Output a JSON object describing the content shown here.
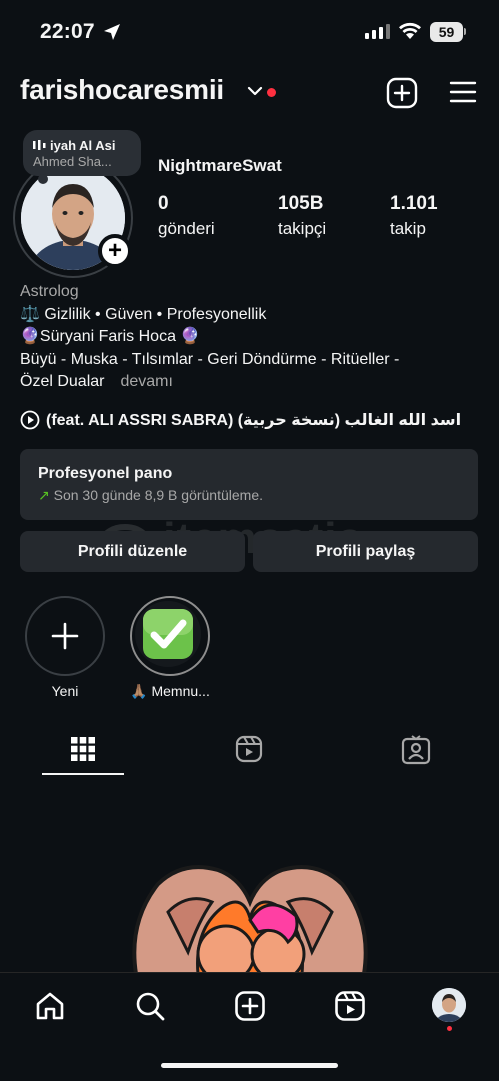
{
  "status_bar": {
    "time": "22:07",
    "battery": "59"
  },
  "header": {
    "username": "farishocaresmii"
  },
  "note": {
    "title": "iyah Al Asi",
    "subtitle": "Ahmed Sha..."
  },
  "profile": {
    "display_name": "NightmareSwat",
    "stats": [
      {
        "value": "0",
        "label": "gönderi"
      },
      {
        "value": "105B",
        "label": "takipçi"
      },
      {
        "value": "1.101",
        "label": "takip"
      }
    ]
  },
  "bio": {
    "category": "Astrolog",
    "line1": "⚖️ Gizlilik • Güven • Profesyonellik",
    "line2": "🔮Süryani Faris Hoca 🔮",
    "line3": "Büyü - Muska - Tılsımlar - Geri Döndürme - Ritüeller -",
    "line4": "Özel Dualar",
    "more": "devamı"
  },
  "music": {
    "text": "اسد الله الغالب (نسخة حربية) (feat. ALI ASSRI SABRA)"
  },
  "dashboard": {
    "title": "Profesyonel pano",
    "subtitle": "Son 30 günde 8,9 B görüntüleme."
  },
  "buttons": {
    "edit": "Profili düzenle",
    "share": "Profili paylaş"
  },
  "watermark": "itemsatis",
  "highlights": [
    {
      "label": "Yeni"
    },
    {
      "label": "🙏🏽 Memnu..."
    }
  ],
  "colors": {
    "background": "#0c1014",
    "accent_dot": "#ff3040",
    "surface": "#25292e",
    "trend_green": "#58c322"
  }
}
